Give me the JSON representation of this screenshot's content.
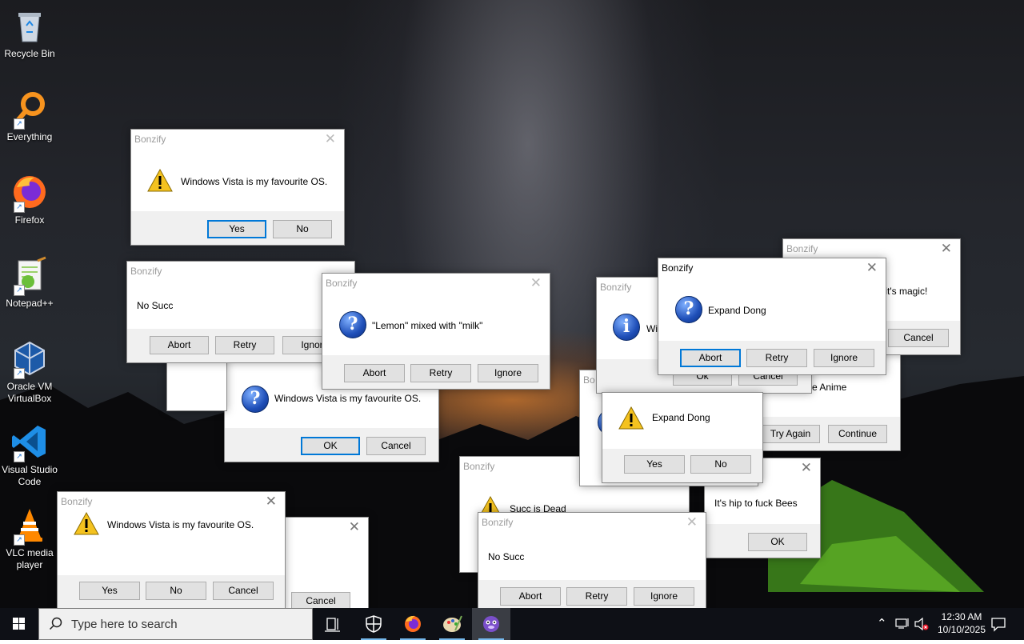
{
  "desktop_icons": [
    {
      "label": "Recycle Bin",
      "icon": "recycle-bin-icon"
    },
    {
      "label": "Everything",
      "icon": "everything-search-icon"
    },
    {
      "label": "Firefox",
      "icon": "firefox-icon"
    },
    {
      "label": "Notepad++",
      "icon": "notepad-plus-plus-icon"
    },
    {
      "label": "Oracle VM VirtualBox",
      "icon": "virtualbox-icon"
    },
    {
      "label": "Visual Studio Code",
      "icon": "vscode-icon"
    },
    {
      "label": "VLC media player",
      "icon": "vlc-icon"
    }
  ],
  "dialogs": {
    "d1": {
      "title": "Bonzify",
      "message": "Windows Vista is my favourite OS.",
      "buttons": [
        "Yes",
        "No"
      ]
    },
    "d2": {
      "title": "Bonzify",
      "message": "No Succ",
      "buttons": [
        "Abort",
        "Retry",
        "Ignor"
      ]
    },
    "d3": {
      "title": "Bonzify",
      "message": "\"Lemon\" mixed with \"milk\"",
      "buttons": [
        "Abort",
        "Retry",
        "Ignore"
      ]
    },
    "d4": {
      "message": "Windows Vista is my favourite OS.",
      "buttons": [
        "OK",
        "Cancel"
      ]
    },
    "d5": {
      "title": "Bonzify",
      "message": "Wi",
      "buttons": [
        "Ok",
        "Cancel"
      ]
    },
    "d6": {
      "title": "Bonzify",
      "message": "Expand Dong",
      "buttons": [
        "Abort",
        "Retry",
        "Ignore"
      ]
    },
    "d7": {
      "title": "Bonzify",
      "message": "l, it's magic!",
      "buttons": [
        "Cancel"
      ]
    },
    "d8": {
      "message": "rite Anime",
      "buttons": [
        "Try Again",
        "Continue"
      ]
    },
    "d9": {
      "title": "Bo"
    },
    "d10": {
      "message": "Expand Dong",
      "buttons": [
        "Yes",
        "No"
      ]
    },
    "d11": {
      "title": "Bonzify",
      "message": "Succ is Dead"
    },
    "d12": {
      "message": "It's hip to fuck Bees",
      "buttons": [
        "OK"
      ]
    },
    "d13": {
      "title": "Bonzify",
      "message": "No Succ",
      "buttons": [
        "Abort",
        "Retry",
        "Ignore"
      ]
    },
    "d14": {
      "title": "Bonzify",
      "message": "Windows Vista is my favourite OS.",
      "buttons": [
        "Yes",
        "No",
        "Cancel"
      ]
    },
    "d15": {
      "buttons": [
        "Cancel"
      ]
    }
  },
  "taskbar": {
    "search_placeholder": "Type here to search",
    "time": "12:30 AM",
    "date": "10/10/2025"
  },
  "colors": {
    "accent": "#0078d7",
    "taskbar": "#0e1016"
  }
}
